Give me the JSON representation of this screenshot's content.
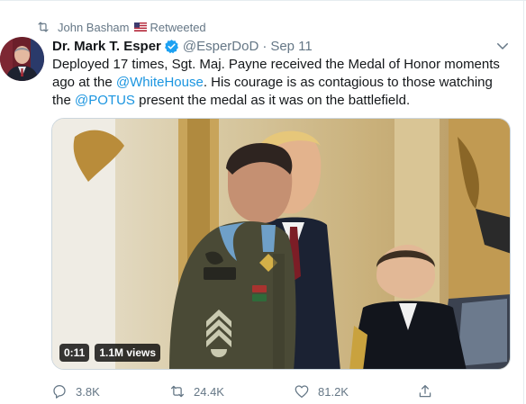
{
  "retweet": {
    "user": "John Basham",
    "label": "Retweeted"
  },
  "tweet": {
    "display_name": "Dr. Mark T. Esper",
    "handle": "@EsperDoD",
    "separator": "·",
    "date": "Sep 11",
    "text": {
      "line1": "Deployed 17 times, Sgt. Maj. Payne received the Medal of Honor moments",
      "line2_pre": "ago at the ",
      "line2_mention": "@WhiteHouse",
      "line2_post": ". His courage is as contagious to those watching",
      "line3_pre": "the ",
      "line3_mention": "@POTUS",
      "line3_post": " present the medal as it was on the battlefield."
    }
  },
  "video": {
    "duration": "0:11",
    "views": "1.1M views"
  },
  "actions": {
    "replies": "3.8K",
    "retweets": "24.4K",
    "likes": "81.2K"
  },
  "colors": {
    "accent": "#1b95e0",
    "verified": "#1da1f2",
    "muted": "#657786",
    "text": "#14171a"
  }
}
